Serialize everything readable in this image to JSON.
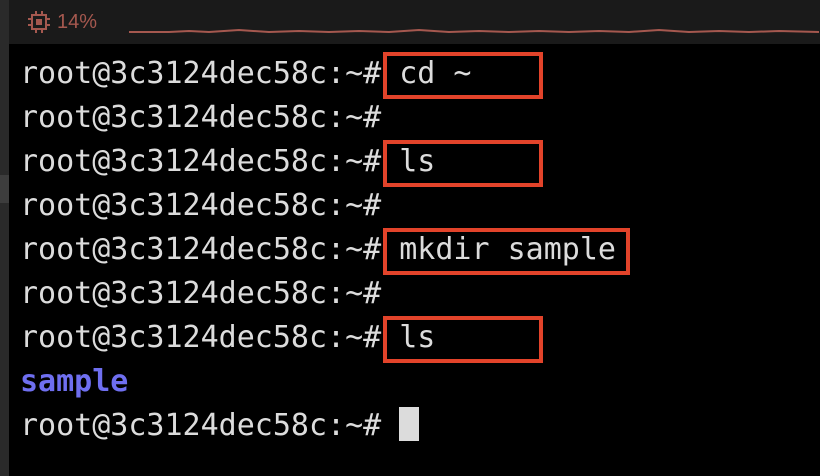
{
  "status": {
    "cpu_icon": "cpu-chip-icon",
    "cpu_percent": "14%",
    "accent_color": "#a5584f"
  },
  "terminal": {
    "lines": [
      {
        "prompt": "root@3c3124dec58c:~#",
        "command": "cd ~",
        "highlighted": true
      },
      {
        "prompt": "root@3c3124dec58c:~#",
        "command": "",
        "highlighted": false
      },
      {
        "prompt": "root@3c3124dec58c:~#",
        "command": "ls",
        "highlighted": true
      },
      {
        "prompt": "root@3c3124dec58c:~#",
        "command": "",
        "highlighted": false
      },
      {
        "prompt": "root@3c3124dec58c:~#",
        "command": "mkdir sample",
        "highlighted": true
      },
      {
        "prompt": "root@3c3124dec58c:~#",
        "command": "",
        "highlighted": false
      },
      {
        "prompt": "root@3c3124dec58c:~#",
        "command": "ls",
        "highlighted": true
      },
      {
        "output": "sample",
        "type": "directory"
      },
      {
        "prompt": "root@3c3124dec58c:~#",
        "command": "",
        "cursor": true
      }
    ],
    "colors": {
      "background": "#000000",
      "text": "#dcdcdc",
      "directory": "#6f6ff0",
      "highlight_box": "#e2432a"
    }
  }
}
